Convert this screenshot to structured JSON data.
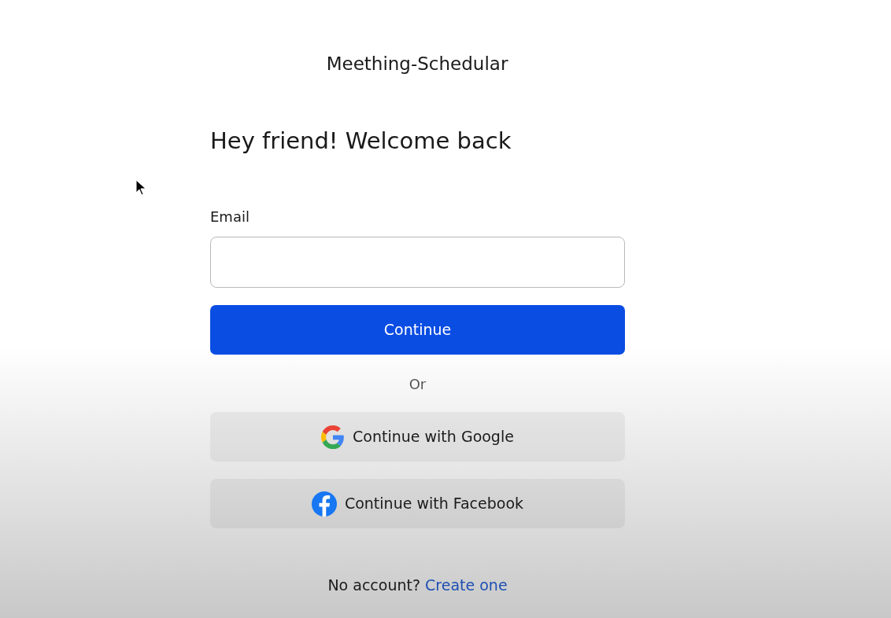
{
  "app_title": "Meething-Schedular",
  "heading": "Hey friend! Welcome back",
  "email_field": {
    "label": "Email"
  },
  "continue_button": "Continue",
  "divider_text": "Or",
  "social_buttons": [
    {
      "kind": "google",
      "label": "Continue with Google"
    },
    {
      "kind": "facebook",
      "label": "Continue with Facebook"
    }
  ],
  "footer": {
    "text": "No account?",
    "link": "Create one"
  }
}
